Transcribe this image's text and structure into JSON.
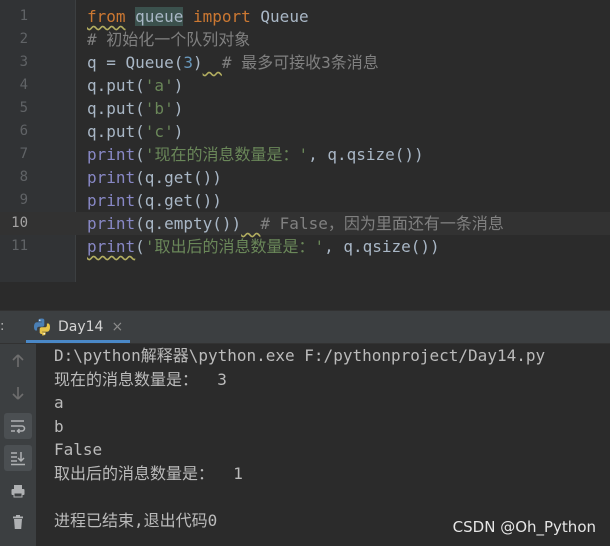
{
  "editor": {
    "current_line": 10,
    "line_numbers": [
      "1",
      "2",
      "3",
      "4",
      "5",
      "6",
      "7",
      "8",
      "9",
      "10",
      "11"
    ]
  },
  "code": {
    "l1": {
      "from": "from",
      "sp1": " ",
      "queue": "queue",
      "sp2": " ",
      "import": "import",
      "rest": " Queue"
    },
    "l2": {
      "comment": "# 初始化一个队列对象"
    },
    "l3": {
      "a": "q = Queue(",
      "n": "3",
      "b": ")",
      "c": "  ",
      "comment": "# 最多可接收3条消息"
    },
    "l4": {
      "a": "q.put(",
      "s": "'a'",
      "b": ")"
    },
    "l5": {
      "a": "q.put(",
      "s": "'b'",
      "b": ")"
    },
    "l6": {
      "a": "q.put(",
      "s": "'c'",
      "b": ")"
    },
    "l7": {
      "fn": "print",
      "a": "(",
      "s": "'现在的消息数量是：'",
      "b": ", q.qsize())"
    },
    "l8": {
      "fn": "print",
      "a": "(q.get())"
    },
    "l9": {
      "fn": "print",
      "a": "(q.get())"
    },
    "l10": {
      "fn": "print",
      "a": "(q.empty())",
      "c": "  ",
      "comment": "# False，因为里面还有一条消息"
    },
    "l11": {
      "fn": "print",
      "a": "(",
      "s": "'取出后的消息数量是：'",
      "b": ", q.qsize())"
    }
  },
  "run_panel": {
    "label": ":",
    "tab_title": "Day14",
    "close_glyph": "×"
  },
  "console": {
    "lines": [
      "D:\\python解释器\\python.exe F:/pythonproject/Day14.py",
      "现在的消息数量是：  3",
      "a",
      "b",
      "False",
      "取出后的消息数量是：  1",
      "",
      "进程已结束,退出代码0"
    ]
  },
  "watermark": "CSDN @Oh_Python",
  "colors": {
    "keyword": "#cc7832",
    "builtin": "#8888c6",
    "string": "#6a8759",
    "number": "#6897bb",
    "comment": "#808080",
    "accent": "#4a88c7"
  }
}
